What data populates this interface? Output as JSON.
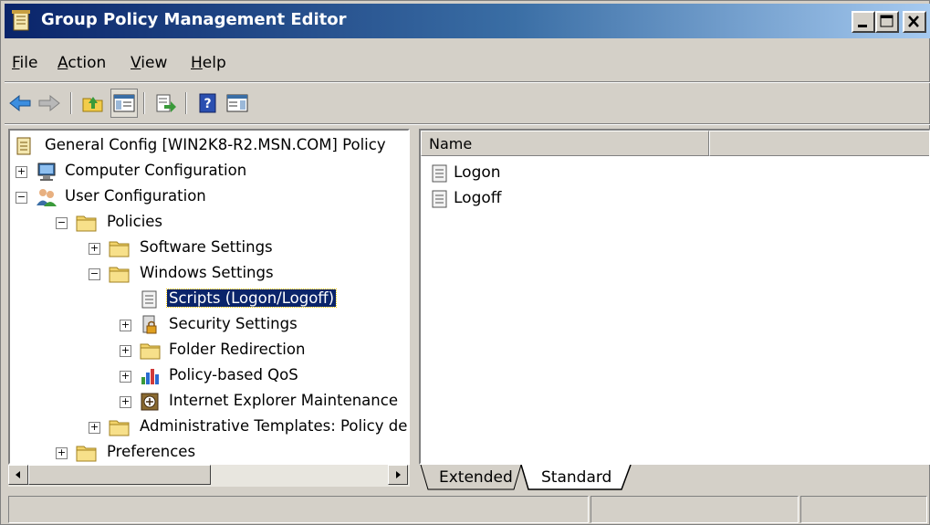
{
  "window": {
    "title": "Group Policy Management Editor"
  },
  "menu": {
    "file": {
      "ul": "F",
      "rest": "ile"
    },
    "action": {
      "ul": "A",
      "rest": "ction"
    },
    "view": {
      "ul": "V",
      "rest": "iew"
    },
    "help": {
      "ul": "H",
      "rest": "elp"
    }
  },
  "toolbar": {
    "buttons": [
      "back-icon",
      "forward-icon",
      "up-folder-icon",
      "show-hide-tree-icon",
      "export-list-icon",
      "help-icon",
      "action-pane-icon"
    ]
  },
  "tree": {
    "root": "General Config [WIN2K8-R2.MSN.COM] Policy",
    "computer_configuration": "Computer Configuration",
    "user_configuration": "User Configuration",
    "policies": "Policies",
    "software_settings": "Software Settings",
    "windows_settings": "Windows Settings",
    "scripts": "Scripts (Logon/Logoff)",
    "security_settings": "Security Settings",
    "folder_redirection": "Folder Redirection",
    "policy_based_qos": "Policy-based QoS",
    "ie_maintenance": "Internet Explorer Maintenance",
    "admin_templates": "Administrative Templates: Policy de",
    "preferences": "Preferences"
  },
  "list": {
    "columns": [
      "Name",
      ""
    ],
    "items": [
      "Logon",
      "Logoff"
    ]
  },
  "tabs": [
    "Extended",
    "Standard"
  ],
  "colors": {
    "selection": "#0a246a",
    "titlebar_start": "#0a246a",
    "titlebar_end": "#a6caf0"
  }
}
